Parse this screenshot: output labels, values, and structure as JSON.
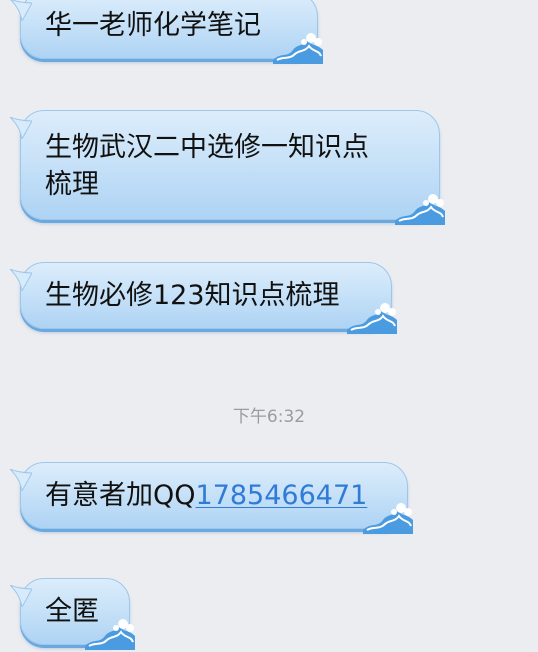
{
  "messages": [
    {
      "text": "华一老师化学笔记"
    },
    {
      "text_line1": "生物武汉二中选修一知识点",
      "text_line2": "梳理"
    },
    {
      "text": "生物必修123知识点梳理"
    },
    {
      "text_prefix": "有意者加QQ",
      "link": "1785466471"
    },
    {
      "text": "全匿"
    }
  ],
  "timestamp": "下午6:32",
  "colors": {
    "background": "#ecedf1",
    "bubble_top": "#dcedfb",
    "bubble_bottom": "#aed3f4",
    "link": "#2f7bd6",
    "timestamp": "#9a9ca2"
  }
}
